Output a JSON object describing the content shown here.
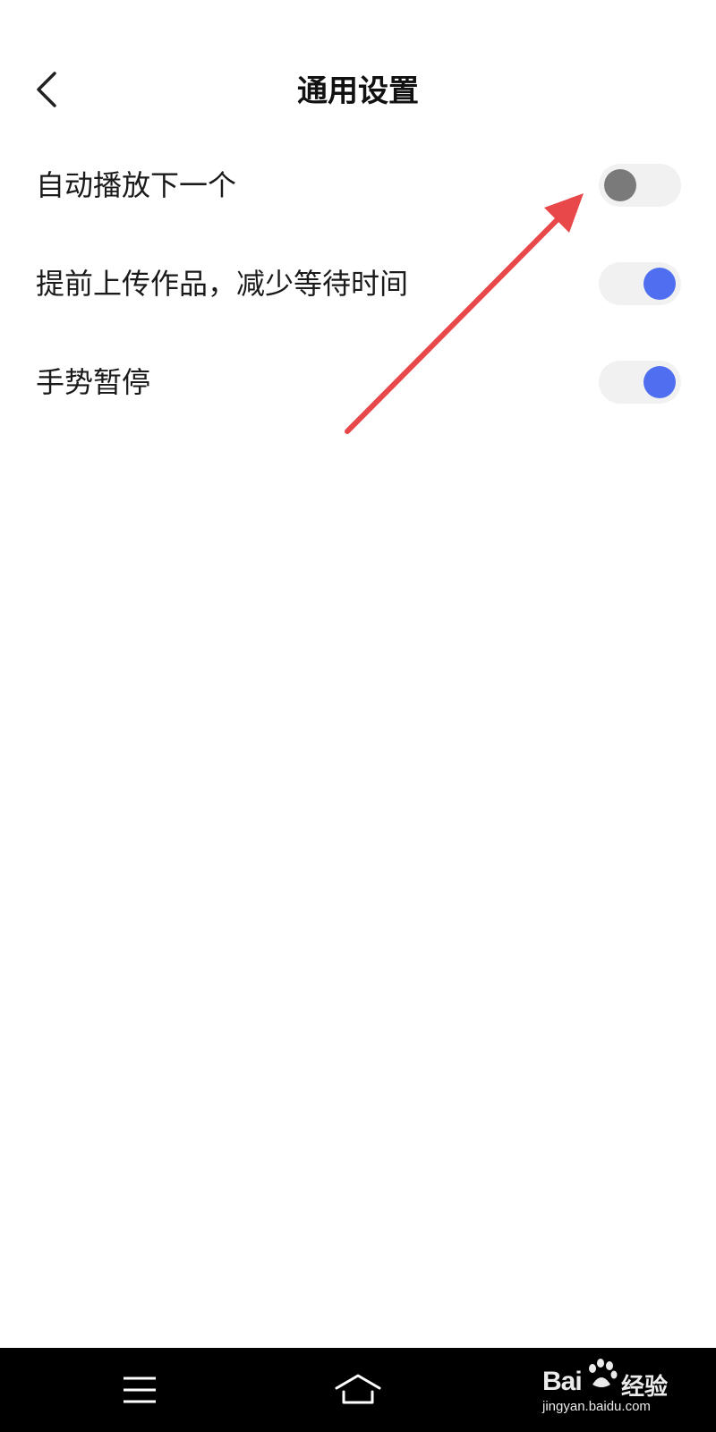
{
  "header": {
    "title": "通用设置",
    "back_icon": "chevron-left-icon"
  },
  "settings": [
    {
      "label": "自动播放下一个",
      "enabled": false
    },
    {
      "label": "提前上传作品，减少等待时间",
      "enabled": true
    },
    {
      "label": "手势暂停",
      "enabled": true
    }
  ],
  "colors": {
    "toggle_on": "#4f6ff0",
    "toggle_off_knob": "#7a7a7a",
    "toggle_track": "#f1f1f1",
    "annotation_arrow": "#e8484a",
    "navbar": "#000000"
  },
  "navbar": {
    "menu_icon": "menu-icon",
    "home_icon": "home-icon"
  },
  "watermark": {
    "brand": "Bai",
    "suffix": "经验",
    "url": "jingyan.baidu.com"
  }
}
